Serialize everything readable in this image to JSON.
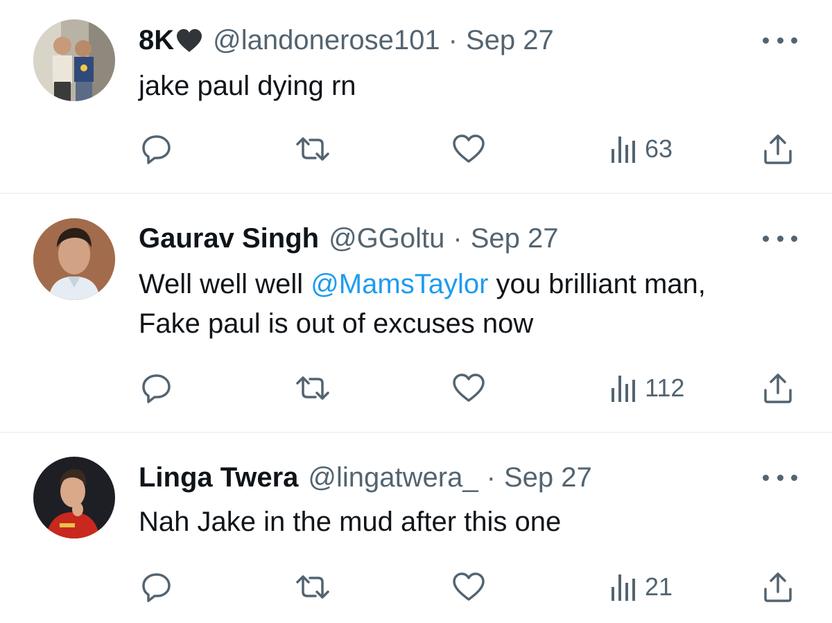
{
  "tweets": [
    {
      "name": "8K",
      "handle": "@landonerose101",
      "separator": "·",
      "date": "Sep 27",
      "text": "jake paul dying rn",
      "views": "63",
      "name_emoji": "black-heart-icon"
    },
    {
      "name": "Gaurav Singh",
      "handle": "@GGoltu",
      "separator": "·",
      "date": "Sep 27",
      "text_before": "Well well well ",
      "mention": "@MamsTaylor",
      "text_after_line1": " you brilliant man,",
      "text_line2": "Fake paul is out of excuses now",
      "views": "112"
    },
    {
      "name": "Linga Twera",
      "handle": "@lingatwera_",
      "separator": "·",
      "date": "Sep 27",
      "text": "Nah Jake in the mud after this one",
      "views": "21"
    }
  ],
  "icons": {
    "reply": "reply-icon",
    "retweet": "retweet-icon",
    "like": "like-icon",
    "views": "views-icon",
    "share": "share-icon",
    "more": "more-icon"
  },
  "colors": {
    "text": "#0f1419",
    "secondary": "#536471",
    "link": "#1d9bf0",
    "divider": "#eff3f4"
  }
}
